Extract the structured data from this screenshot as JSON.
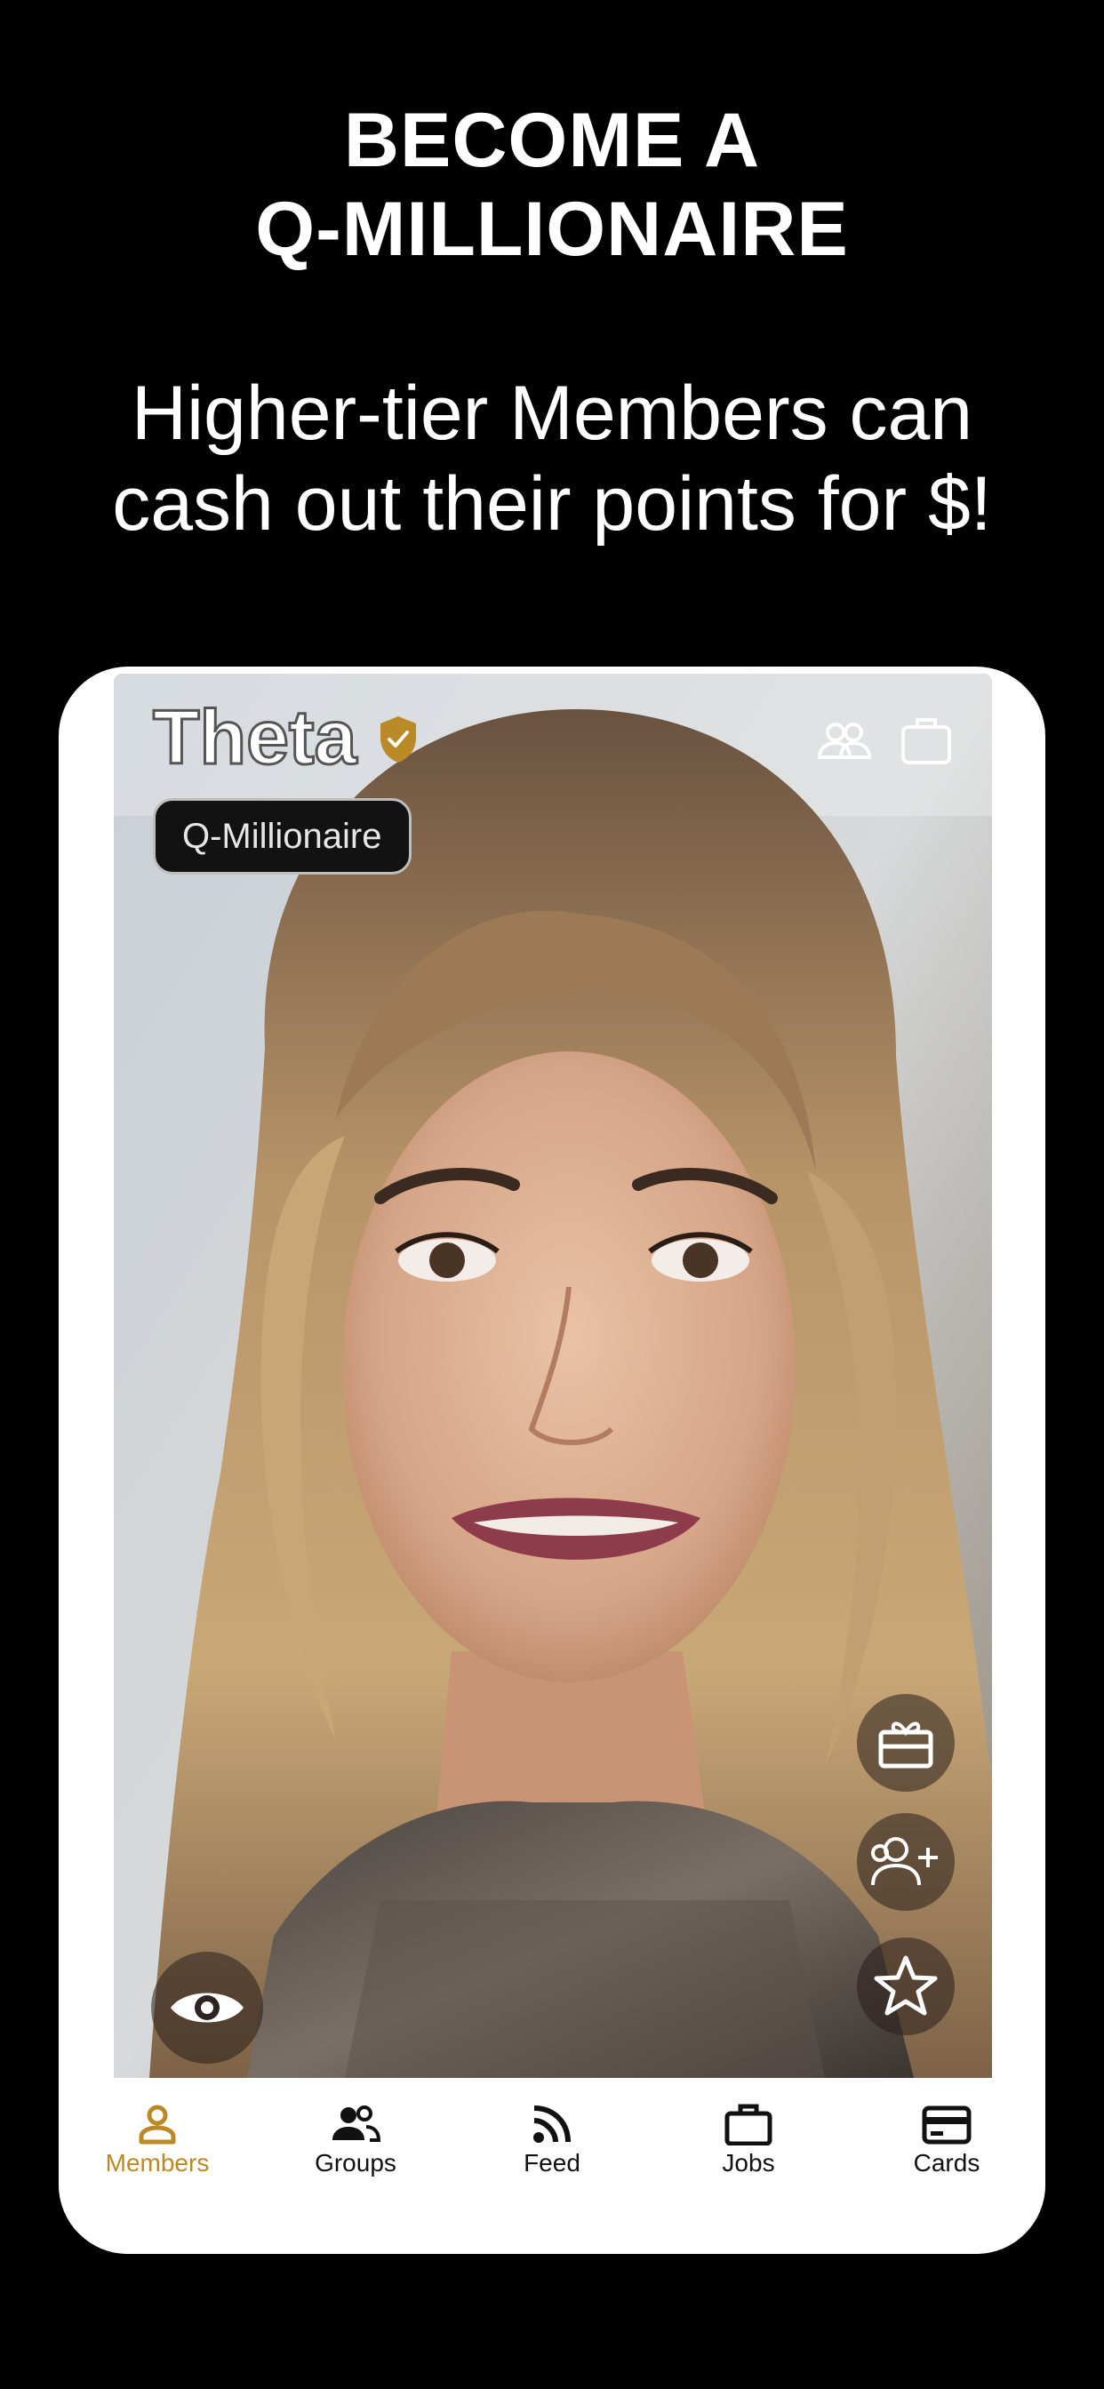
{
  "promo": {
    "headline_line1": "BECOME A",
    "headline_line2": "Q-MILLIONAIRE",
    "subhead_line1": "Higher-tier Members can",
    "subhead_line2": "cash out their points for $!"
  },
  "profile": {
    "name": "Theta",
    "tier_badge": "Q-Millionaire",
    "verified_icon": "shield-check-icon",
    "photo": "woman-portrait-photo"
  },
  "top_actions": [
    {
      "icon": "groups-icon"
    },
    {
      "icon": "briefcase-icon"
    }
  ],
  "side_actions": [
    {
      "icon": "gift-card-icon"
    },
    {
      "icon": "add-friend-icon"
    },
    {
      "icon": "star-icon"
    }
  ],
  "view_action": {
    "icon": "eye-icon"
  },
  "tabs": [
    {
      "label": "Members",
      "icon": "person-icon",
      "active": true
    },
    {
      "label": "Groups",
      "icon": "groups-icon",
      "active": false
    },
    {
      "label": "Feed",
      "icon": "rss-feed-icon",
      "active": false
    },
    {
      "label": "Jobs",
      "icon": "briefcase-icon",
      "active": false
    },
    {
      "label": "Cards",
      "icon": "credit-card-icon",
      "active": false
    }
  ],
  "colors": {
    "background": "#000000",
    "accent_gold": "#b98a25",
    "card": "#ffffff"
  }
}
